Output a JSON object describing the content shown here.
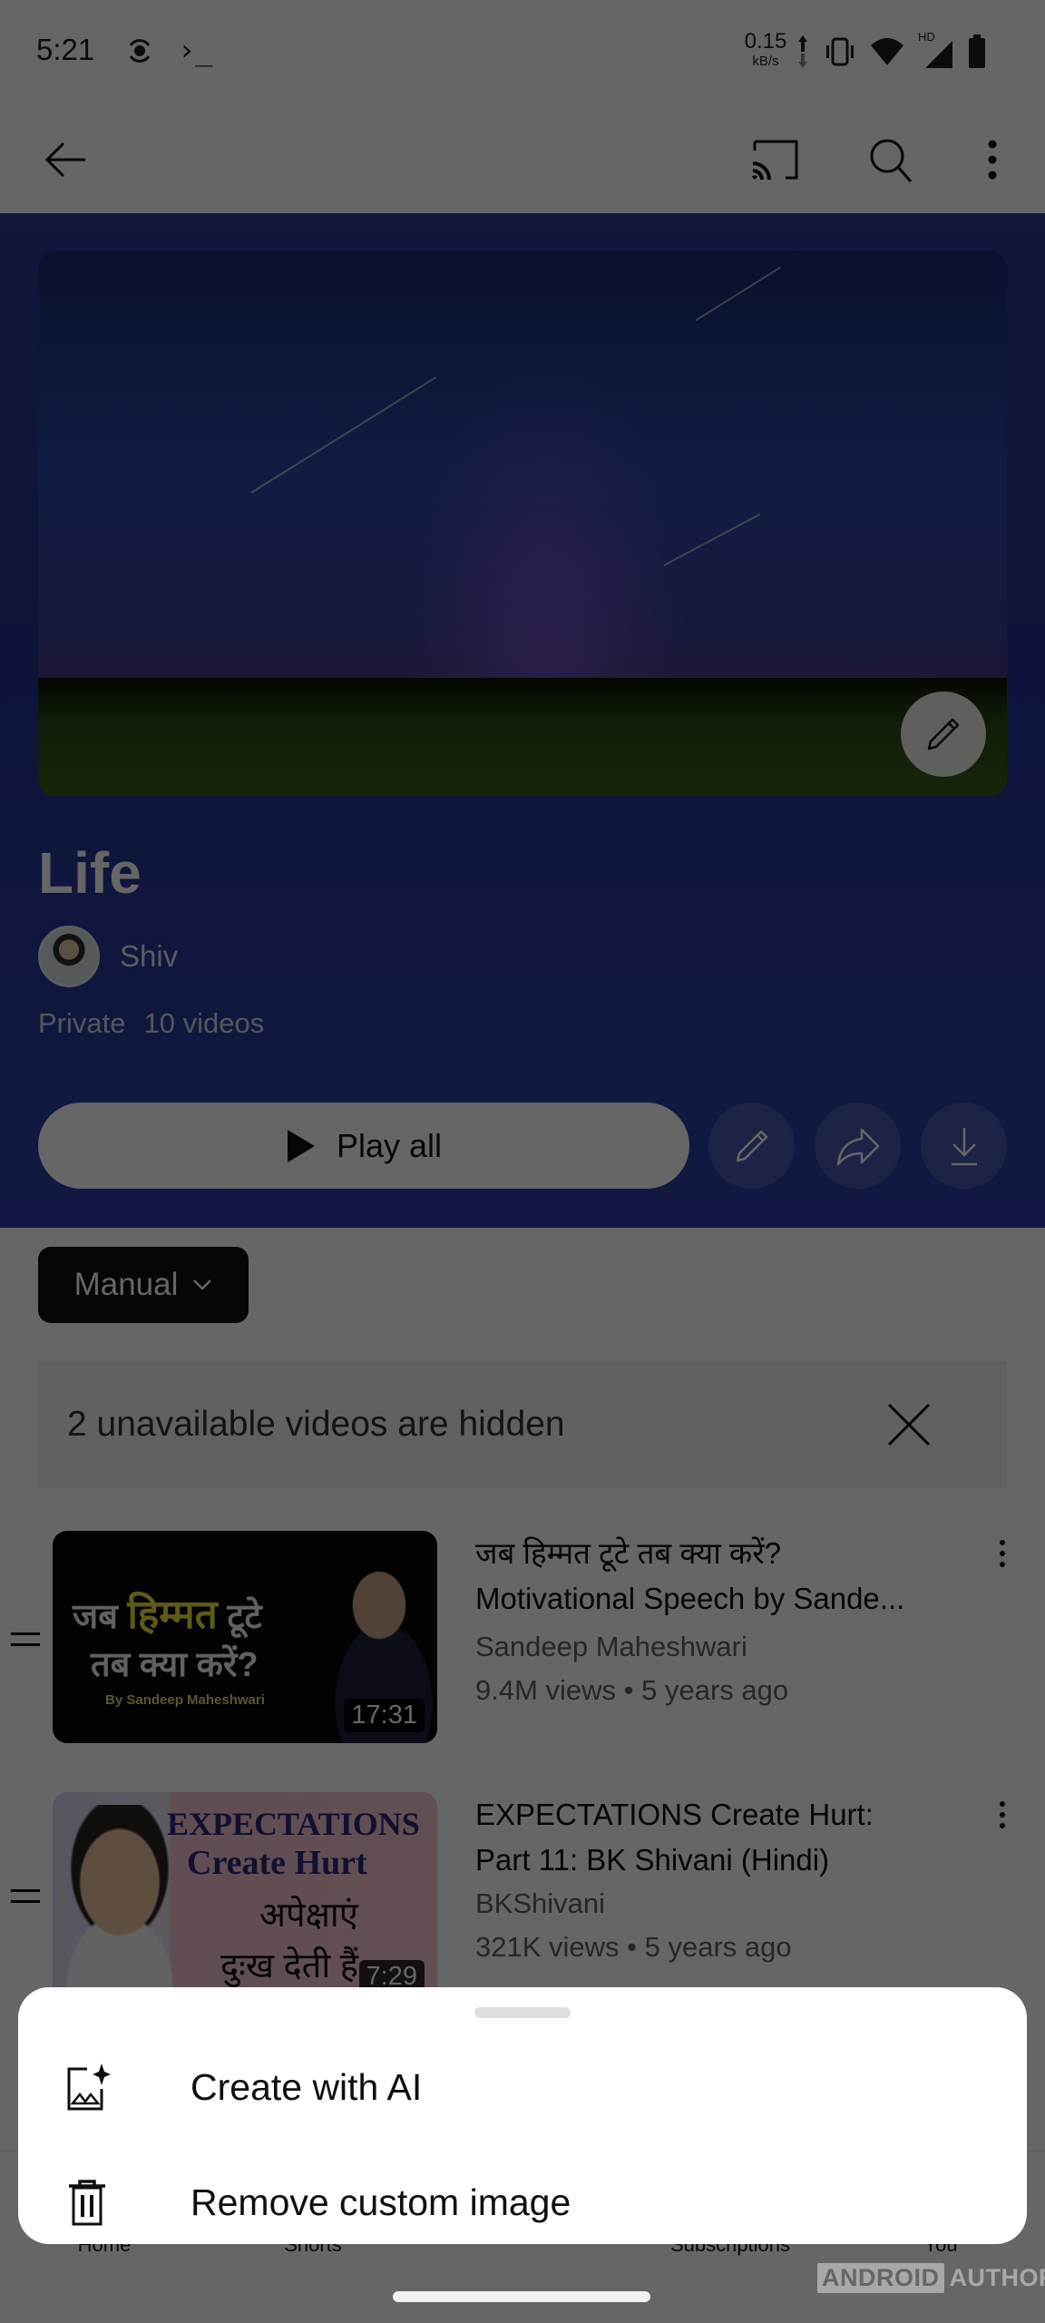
{
  "status_bar": {
    "time": "5:21",
    "terminal_glyph": "›_",
    "net_speed_value": "0.15",
    "net_speed_unit": "kB/s",
    "signal_badge": "HD",
    "icons": [
      "screen-record-icon",
      "terminal-icon",
      "upload-arrow-icon",
      "download-arrow-icon",
      "vibrate-icon",
      "wifi-icon",
      "cell-signal-icon",
      "battery-icon"
    ]
  },
  "app_bar": {
    "icons": [
      "back-arrow-icon",
      "cast-icon",
      "search-icon",
      "more-vert-icon"
    ]
  },
  "playlist": {
    "title": "Life",
    "owner": "Shiv",
    "privacy": "Private",
    "video_count": "10 videos",
    "play_all_label": "Play all",
    "action_icons": [
      "pencil-icon",
      "share-icon",
      "download-icon"
    ]
  },
  "sort": {
    "selected": "Manual"
  },
  "hidden_notice": {
    "text": "2 unavailable videos are hidden"
  },
  "videos": [
    {
      "title": "जब हिम्मत टूटे तब क्या करें? Motivational Speech by Sande...",
      "title_line1": "जब हिम्मत टूटे तब क्या करें?",
      "title_line2": "Motivational Speech by Sande...",
      "channel": "Sandeep Maheshwari",
      "stats": "9.4M views • 5 years ago",
      "duration": "17:31",
      "thumb_text": [
        "जब",
        "हिम्मत",
        "टूटे",
        "तब क्या करें?",
        "By Sandeep Maheshwari"
      ]
    },
    {
      "title": "EXPECTATIONS Create Hurt: Part 11: BK Shivani (Hindi)",
      "title_line1": "EXPECTATIONS Create Hurt:",
      "title_line2": "Part 11: BK Shivani (Hindi)",
      "channel": "BKShivani",
      "stats": "321K views • 5 years ago",
      "duration": "7:29",
      "thumb_text": [
        "EXPECTATIONS",
        "Create Hurt",
        "अपेक्षाएं",
        "दुःख देती हैं"
      ]
    }
  ],
  "bottom_nav": {
    "items": [
      "Home",
      "Shorts",
      "",
      "Subscriptions",
      "You"
    ]
  },
  "sheet": {
    "items": [
      {
        "label": "Create with AI",
        "icon": "ai-image-sparkle-icon"
      },
      {
        "label": "Remove custom image",
        "icon": "trash-icon"
      }
    ]
  },
  "watermark": {
    "boxed": "ANDROID",
    "text": "AUTHORITY"
  },
  "colors": {
    "header_bg": "#2a3a93",
    "scrim": "rgba(0,0,0,0.6)",
    "sheet_bg": "#ffffff"
  }
}
